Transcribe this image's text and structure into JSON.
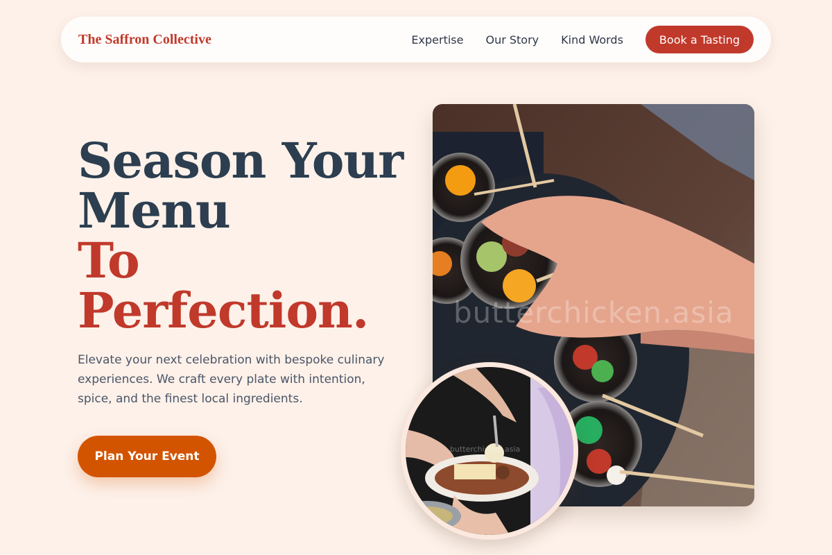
{
  "nav": {
    "brand": "The Saffron Collective",
    "links": [
      "Expertise",
      "Our Story",
      "Kind Words"
    ],
    "cta": "Book a Tasting"
  },
  "hero": {
    "line1": "Season Your",
    "line2": "Menu",
    "line3": "To",
    "line4": "Perfection.",
    "description": "Elevate your next celebration with bespoke culinary experiences. We craft every plate with intention, spice, and the finest local ingredients.",
    "cta": "Plan Your Event",
    "watermark": "butterchicken.asia"
  },
  "colors": {
    "background": "#fdf1e9",
    "brand_red": "#c0392b",
    "heading_dark": "#2c3e50",
    "cta_orange": "#d35400"
  }
}
